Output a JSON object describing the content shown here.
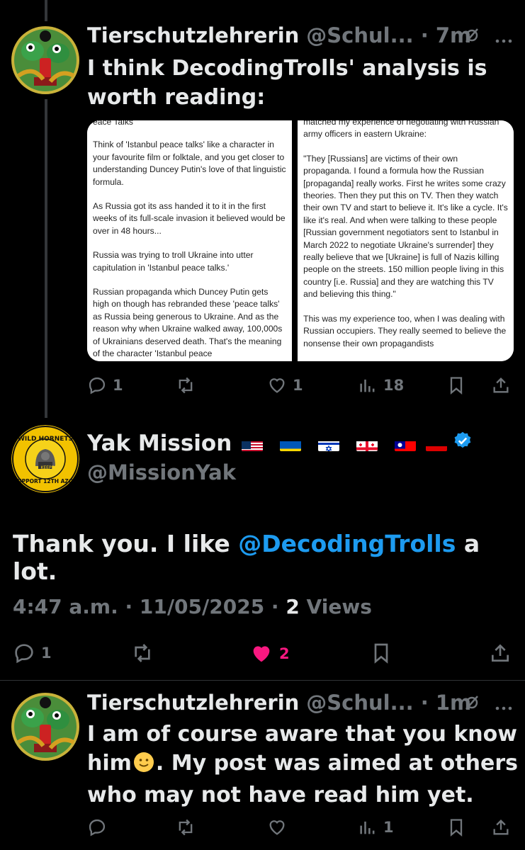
{
  "post1": {
    "name": "Tierschutzlehrerin",
    "handle_time": "@Schul... · 7m",
    "text_line1": "I think DecodingTrolls' analysis is",
    "text_line2": "worth reading:",
    "media_left": [
      "eace Talks",
      "Think of 'Istanbul peace talks' like a character in your favourite film or folktale, and you get closer to understanding Duncey Putin's love of that linguistic formula.",
      "As Russia got its ass handed it to it in the first weeks of its full-scale invasion it believed would be over in 48 hours...",
      "Russia was trying to troll Ukraine into utter capitulation in 'Istanbul peace talks.'",
      "Russian propaganda which Duncey Putin gets high on though has rebranded these 'peace talks' as Russia being generous to Ukraine. And as the reason why when Ukraine walked away, 100,000s of Ukrainians deserved death. That's the meaning of the character 'Istanbul peace"
    ],
    "media_right": [
      "matched my experience of negotiating with Russian army officers in eastern Ukraine:",
      "\"They [Russians] are victims of their own propaganda. I found a formula how the Russian [propaganda] really works. First he writes some crazy theories. Then they put this on TV. Then they watch their own TV and start to believe it. It's like a cycle. It's like it's real. And when were talking to these people [Russian government negotiators sent to Istanbul in March 2022 to negotiate Ukraine's surrender] they really believe that we [Ukraine] is full of Nazis killing people on the streets. 150 million people living in this country [i.e. Russia] and they are watching this TV and believing this thing.\"",
      "This was my experience too, when I was dealing with Russian occupiers. They really seemed to believe the nonsense their own propagandists"
    ],
    "replies": "1",
    "likes": "1",
    "views": "18"
  },
  "main": {
    "name": "Yak Mission",
    "handle": "@MissionYak",
    "text_before": "Thank you. I like ",
    "mention": "@DecodingTrolls",
    "text_after": " a lot.",
    "time": "4:47 a.m. · 11/05/2025 · ",
    "views_count": "2",
    "views_label": " Views",
    "replies": "1",
    "likes": "2",
    "avatar_text_top": "WILD HORNETS",
    "avatar_text_bottom": "SUPPORT 12TH AZOV",
    "avatar_text_center": "KEEPER"
  },
  "post3": {
    "name": "Tierschutzlehrerin",
    "handle_time": "@Schul... · 1m",
    "line1": "I am of course aware that you know",
    "line2a": "him",
    "line2b": ". My post was aimed at others",
    "line3": "who may not have read him yet.",
    "views": "1"
  },
  "colors": {
    "accent": "#1d9bf0",
    "like": "#f91880",
    "muted": "#71767b",
    "text": "#e7e9ea"
  }
}
